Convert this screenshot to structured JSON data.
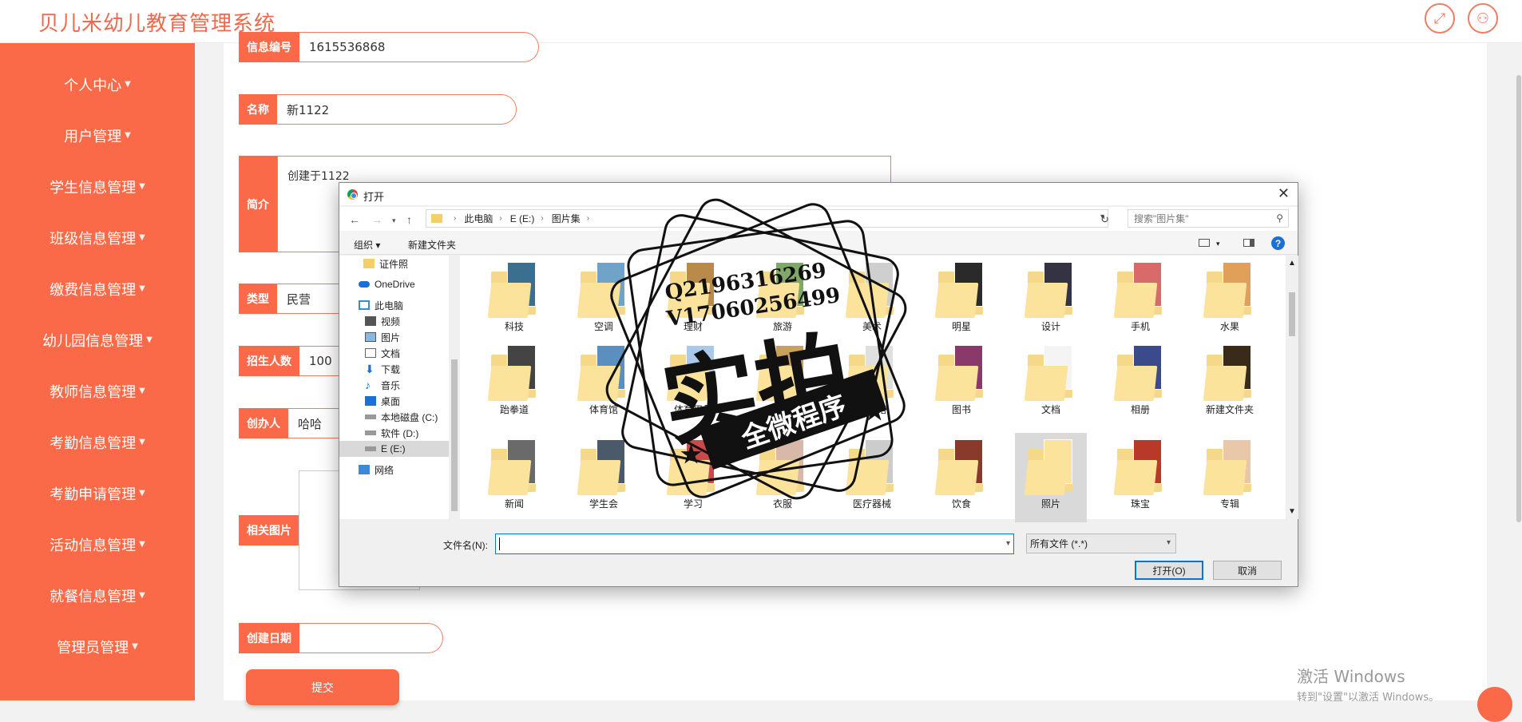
{
  "app": {
    "title": "贝儿米幼儿教育管理系统"
  },
  "header_icons": [
    "fullscreen-icon",
    "user-icon"
  ],
  "colors": {
    "accent": "#fa6a48",
    "dialog_bg": "#f0f0f0",
    "focus": "#0078d7"
  },
  "sidebar": {
    "items": [
      {
        "label": "个人中心"
      },
      {
        "label": "用户管理"
      },
      {
        "label": "学生信息管理"
      },
      {
        "label": "班级信息管理"
      },
      {
        "label": "缴费信息管理"
      },
      {
        "label": "幼儿园信息管理"
      },
      {
        "label": "教师信息管理"
      },
      {
        "label": "考勤信息管理"
      },
      {
        "label": "考勤申请管理"
      },
      {
        "label": "活动信息管理"
      },
      {
        "label": "就餐信息管理"
      },
      {
        "label": "管理员管理"
      }
    ]
  },
  "form": {
    "info_no": {
      "label": "信息编号",
      "value": "1615536868"
    },
    "name": {
      "label": "名称",
      "value": "新1122"
    },
    "intro": {
      "label": "简介",
      "value": "创建于1122"
    },
    "type": {
      "label": "类型",
      "value": "民营"
    },
    "enroll": {
      "label": "招生人数",
      "value": "100"
    },
    "founder": {
      "label": "创办人",
      "value": "哈哈"
    },
    "image": {
      "label": "相关图片"
    },
    "created": {
      "label": "创建日期",
      "value": ""
    },
    "submit_label": "提交"
  },
  "dialog": {
    "title": "打开",
    "breadcrumb": [
      "此电脑",
      "E (E:)",
      "图片集"
    ],
    "search_placeholder": "搜索\"图片集\"",
    "toolbar": {
      "organize": "组织",
      "new_folder": "新建文件夹"
    },
    "nav_items": [
      {
        "label": "证件照",
        "icon": "folder-icon"
      },
      {
        "label": "OneDrive",
        "icon": "cloud-icon"
      },
      {
        "label": "此电脑",
        "icon": "computer-icon"
      },
      {
        "label": "视频",
        "icon": "video-icon"
      },
      {
        "label": "图片",
        "icon": "picture-icon"
      },
      {
        "label": "文档",
        "icon": "document-icon"
      },
      {
        "label": "下载",
        "icon": "download-icon"
      },
      {
        "label": "音乐",
        "icon": "music-icon"
      },
      {
        "label": "桌面",
        "icon": "desktop-icon"
      },
      {
        "label": "本地磁盘 (C:)",
        "icon": "drive-icon"
      },
      {
        "label": "软件 (D:)",
        "icon": "drive-icon"
      },
      {
        "label": "E (E:)",
        "icon": "drive-icon"
      },
      {
        "label": "网络",
        "icon": "network-icon"
      }
    ],
    "files": [
      {
        "name": "科技",
        "color": "#3a6f8f"
      },
      {
        "name": "空调",
        "color": "#6fa3c8"
      },
      {
        "name": "理财",
        "color": "#b98b4a"
      },
      {
        "name": "旅游",
        "color": "#7fa86a"
      },
      {
        "name": "美术",
        "color": "#cfcfcf"
      },
      {
        "name": "明星",
        "color": "#2a2a2a"
      },
      {
        "name": "设计",
        "color": "#333344"
      },
      {
        "name": "手机",
        "color": "#d86a6a"
      },
      {
        "name": "水果",
        "color": "#e0a05a"
      },
      {
        "name": "跆拳道",
        "color": "#444444"
      },
      {
        "name": "体育馆",
        "color": "#5a8fbf"
      },
      {
        "name": "体育用品",
        "color": "#aac8e8"
      },
      {
        "name": "投影",
        "color": "#c8a060"
      },
      {
        "name": "图书馆",
        "color": "#e0e0e0"
      },
      {
        "name": "图书",
        "color": "#8a3a6a"
      },
      {
        "name": "文档",
        "color": "#f4f4f4"
      },
      {
        "name": "相册",
        "color": "#3a4a8a"
      },
      {
        "name": "新建文件夹",
        "color": "#3a2a1a"
      },
      {
        "name": "新闻",
        "color": "#6a6a6a"
      },
      {
        "name": "学生会",
        "color": "#4a5a6a"
      },
      {
        "name": "学习",
        "color": "#c84a4a"
      },
      {
        "name": "衣服",
        "color": "#d8b8a8"
      },
      {
        "name": "医疗器械",
        "color": "#cccccc"
      },
      {
        "name": "饮食",
        "color": "#8a3a2a"
      },
      {
        "name": "照片",
        "color": "#fbe39c"
      },
      {
        "name": "珠宝",
        "color": "#b8382a"
      },
      {
        "name": "专辑",
        "color": "#e8c8a8"
      }
    ],
    "selected_file": "照片",
    "filename_label": "文件名(N):",
    "filename_value": "",
    "filetype_value": "所有文件 (*.*)",
    "open_label": "打开(O)",
    "cancel_label": "取消"
  },
  "overlay_stamp": {
    "line1": "Q2196316269",
    "line2": "V17060256499",
    "main": "实拍",
    "banner": "全微程序"
  },
  "windows_watermark": {
    "line1": "激活 Windows",
    "line2": "转到\"设置\"以激活 Windows。"
  }
}
